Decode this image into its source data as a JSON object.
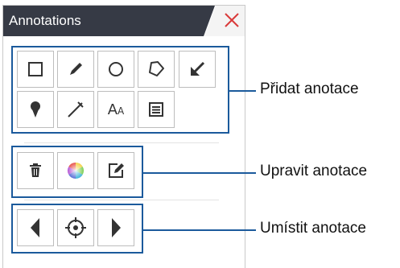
{
  "panel": {
    "title": "Annotations",
    "close_icon": "close-x-icon",
    "colors": {
      "titlebar": "#363a45",
      "close": "#d93a3a",
      "group_frame": "#1b5a9c",
      "icon": "#333333"
    }
  },
  "groups": [
    {
      "id": "add",
      "callout": "Přidat anotace",
      "tools": [
        {
          "icon": "rectangle-icon",
          "label": ""
        },
        {
          "icon": "pencil-icon",
          "label": ""
        },
        {
          "icon": "circle-icon",
          "label": ""
        },
        {
          "icon": "polygon-icon",
          "label": ""
        },
        {
          "icon": "arrow-icon",
          "label": ""
        },
        {
          "icon": "pin-icon",
          "label": ""
        },
        {
          "icon": "measure-icon",
          "label": ""
        },
        {
          "icon": "text-icon",
          "label": "AA"
        },
        {
          "icon": "note-icon",
          "label": ""
        }
      ]
    },
    {
      "id": "edit",
      "callout": "Upravit anotace",
      "tools": [
        {
          "icon": "trash-icon",
          "label": ""
        },
        {
          "icon": "color-wheel-icon",
          "label": ""
        },
        {
          "icon": "edit-icon",
          "label": ""
        }
      ]
    },
    {
      "id": "place",
      "callout": "Umístit anotace",
      "tools": [
        {
          "icon": "arrow-left-icon",
          "label": ""
        },
        {
          "icon": "target-icon",
          "label": ""
        },
        {
          "icon": "arrow-right-icon",
          "label": ""
        }
      ]
    }
  ]
}
